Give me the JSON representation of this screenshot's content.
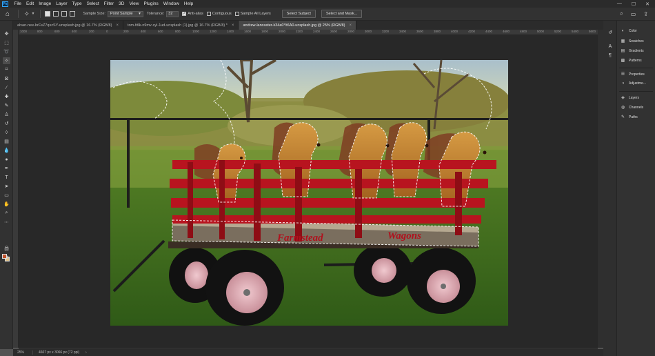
{
  "app": {
    "logo": "Ps"
  },
  "menubar": {
    "items": [
      "File",
      "Edit",
      "Image",
      "Layer",
      "Type",
      "Select",
      "Filter",
      "3D",
      "View",
      "Plugins",
      "Window",
      "Help"
    ],
    "window_controls": [
      "—",
      "☐",
      "✕"
    ]
  },
  "options": {
    "sample_size_label": "Sample Size:",
    "sample_size_value": "Point Sample",
    "tolerance_label": "Tolerance:",
    "tolerance_value": "32",
    "antialias_label": "Anti-alias",
    "contiguous_label": "Contiguous",
    "sample_all_layers_label": "Sample All Layers",
    "select_subject_label": "Select Subject",
    "select_mask_label": "Select and Mask..."
  },
  "tabs": [
    {
      "title": "alvan-nee-brFsZ7qszSY-unsplash.jpg @ 16.7% (RGB/8)",
      "active": false
    },
    {
      "title": "tom-fdlk-n9mv-xyl-1ud-unsplash (1).jpg @ 16.7% (RGB/8) *",
      "active": false
    },
    {
      "title": "andrew-lancaster-k34a0Yt6A0-unsplash.jpg @ 25% (RGB/8)",
      "active": true
    }
  ],
  "ruler": {
    "h_labels": [
      "1000",
      "800",
      "600",
      "400",
      "200",
      "0",
      "200",
      "400",
      "600",
      "800",
      "1000",
      "1200",
      "1400",
      "1600",
      "1800",
      "2000",
      "2200",
      "2400",
      "2600",
      "2800",
      "3000",
      "3200",
      "3400",
      "3600",
      "3800",
      "4000",
      "4200",
      "4400",
      "4600",
      "4800",
      "5000",
      "5200",
      "5400",
      "5600",
      "5800"
    ]
  },
  "status": {
    "zoom": "25%",
    "doc_info": "4607 px x 3066 px (72 ppi)",
    "arrow": "›"
  },
  "photo": {
    "wagon_text_left": "Farmstead",
    "wagon_text_right": "Wagons"
  },
  "panels": [
    {
      "label": "Color",
      "icon": "color-wheel-icon"
    },
    {
      "label": "Swatches",
      "icon": "swatches-icon"
    },
    {
      "label": "Gradients",
      "icon": "gradients-icon"
    },
    {
      "label": "Patterns",
      "icon": "patterns-icon"
    },
    {
      "label": "Properties",
      "icon": "properties-icon"
    },
    {
      "label": "Adjustme...",
      "icon": "adjustments-icon"
    },
    {
      "label": "Layers",
      "icon": "layers-icon"
    },
    {
      "label": "Channels",
      "icon": "channels-icon"
    },
    {
      "label": "Paths",
      "icon": "paths-icon"
    }
  ],
  "colors": {
    "foreground": "#c0532d",
    "background": "#e0c28a",
    "accent": "#31a8ff"
  }
}
